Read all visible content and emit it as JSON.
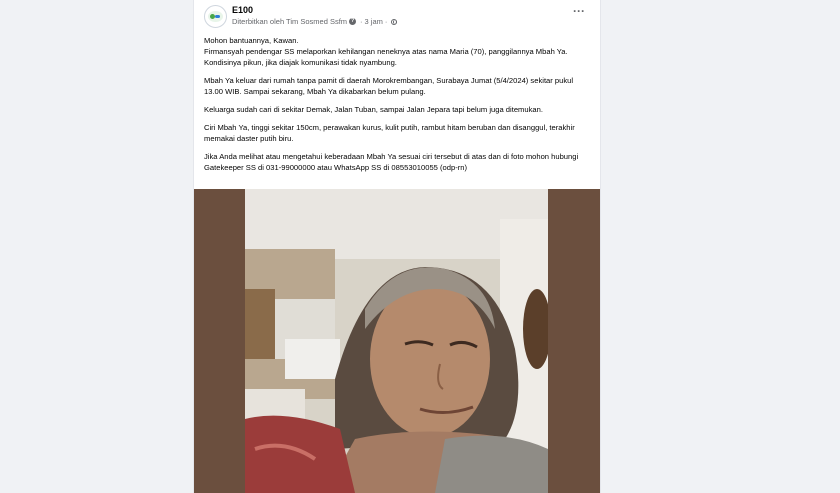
{
  "post": {
    "author": "E100",
    "published_by": "Diterbitkan oleh Tim Sosmed Ssfm",
    "time": "3 jam",
    "more_icon": "more-horizontal-icon",
    "paragraphs": [
      "Mohon bantuannya, Kawan.",
      "Firmansyah pendengar SS melaporkan kehilangan neneknya atas nama Maria (70), panggilannya Mbah Ya. Kondisinya pikun, jika diajak komunikasi tidak nyambung.",
      "Mbah Ya keluar dari rumah tanpa pamit di daerah Morokrembangan, Surabaya Jumat (5/4/2024) sekitar pukul 13.00 WIB. Sampai sekarang, Mbah Ya dikabarkan belum pulang.",
      "Keluarga sudah cari di sekitar Demak, Jalan Tuban, sampai Jalan Jepara tapi belum juga ditemukan.",
      "Ciri Mbah Ya, tinggi sekitar 150cm, perawakan kurus, kulit putih, rambut hitam beruban dan disanggul, terakhir memakai daster putih biru.",
      "Jika Anda melihat atau mengetahui keberadaan Mbah Ya sesuai ciri tersebut di atas dan di foto mohon hubungi Gatekeeper SS di 031-99000000 atau WhatsApp SS di 08553010055 (odp-rn)"
    ]
  },
  "colors": {
    "page_bg": "#f0f2f5",
    "card_bg": "#ffffff",
    "text": "#050505",
    "meta": "#65676b",
    "photo_frame": "#6b4f3e"
  }
}
